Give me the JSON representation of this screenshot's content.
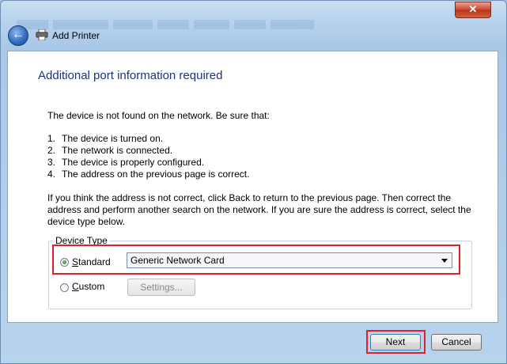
{
  "window": {
    "close_glyph": "✕",
    "title": "Add Printer"
  },
  "icons": {
    "back": "back-arrow-icon",
    "printer": "printer-icon",
    "close": "close-icon"
  },
  "page": {
    "heading": "Additional port information required",
    "intro": "The device is not found on the network.  Be sure that:",
    "steps": [
      {
        "num": "1.",
        "text": "The device is turned on."
      },
      {
        "num": "2.",
        "text": "The network is connected."
      },
      {
        "num": "3.",
        "text": "The device is properly configured."
      },
      {
        "num": "4.",
        "text": "The address on the previous page is correct."
      }
    ],
    "paragraph": "If you think the address is not correct, click Back to return to the previous page.  Then correct the address and perform another search on the network.  If you are sure the address is correct, select the device type below."
  },
  "device_type": {
    "legend": "Device Type",
    "standard_label": "Standard",
    "standard_selected": true,
    "standard_value": "Generic Network Card",
    "custom_label": "Custom",
    "custom_selected": false,
    "settings_label": "Settings..."
  },
  "footer": {
    "next_label": "Next",
    "cancel_label": "Cancel"
  },
  "colors": {
    "heading": "#1e3287",
    "highlight": "#e0202a"
  }
}
